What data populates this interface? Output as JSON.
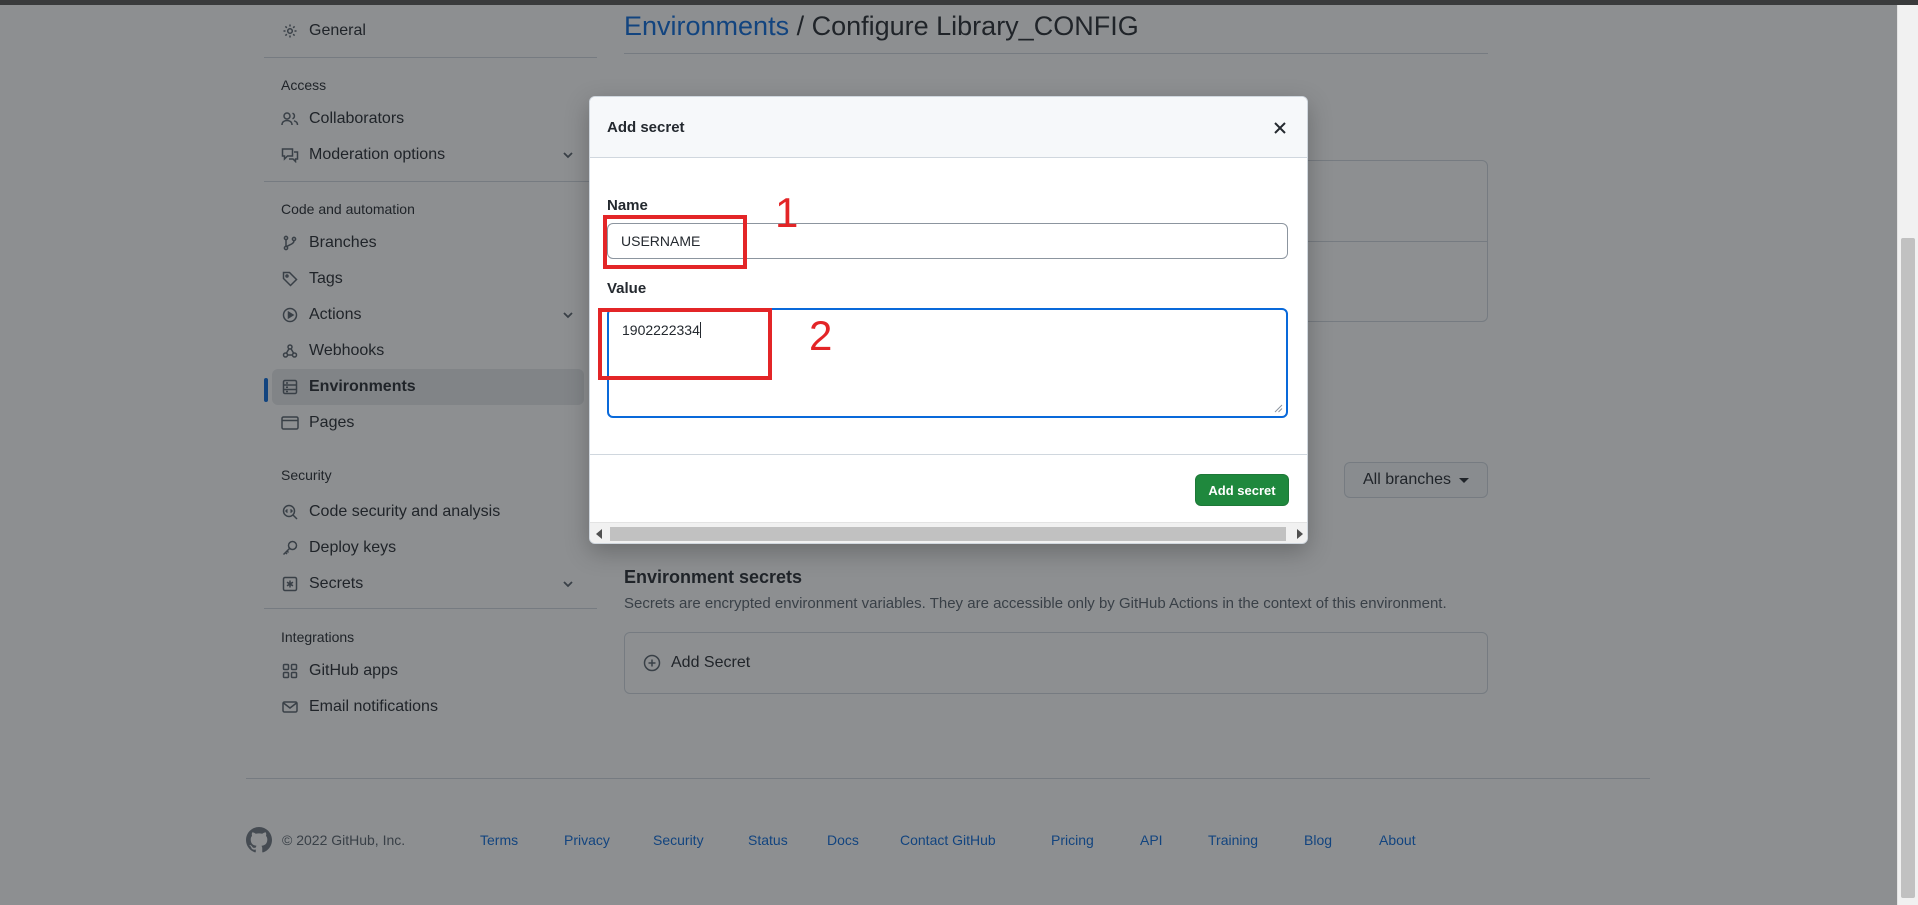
{
  "sidebar": {
    "general": "General",
    "sections": {
      "access": "Access",
      "code": "Code and automation",
      "security": "Security",
      "integrations": "Integrations"
    },
    "items": {
      "collaborators": "Collaborators",
      "moderation": "Moderation options",
      "branches": "Branches",
      "tags": "Tags",
      "actions": "Actions",
      "webhooks": "Webhooks",
      "environments": "Environments",
      "pages": "Pages",
      "code_security": "Code security and analysis",
      "deploy_keys": "Deploy keys",
      "secrets": "Secrets",
      "github_apps": "GitHub apps",
      "email_notifications": "Email notifications"
    }
  },
  "main": {
    "breadcrumb_link": "Environments",
    "breadcrumb_rest": " / Configure Library_CONFIG",
    "branches_button": "All branches",
    "env_secrets_title": "Environment secrets",
    "env_secrets_desc": "Secrets are encrypted environment variables. They are accessible only by GitHub Actions in the context of this environment.",
    "add_secret_link": "Add Secret"
  },
  "dialog": {
    "title": "Add secret",
    "name_label": "Name",
    "name_value": "USERNAME",
    "value_label": "Value",
    "value_value": "1902222334",
    "submit_label": "Add secret"
  },
  "annotations": {
    "one": "1",
    "two": "2"
  },
  "footer": {
    "copyright": "© 2022 GitHub, Inc.",
    "links": {
      "terms": "Terms",
      "privacy": "Privacy",
      "security": "Security",
      "status": "Status",
      "docs": "Docs",
      "contact": "Contact GitHub",
      "pricing": "Pricing",
      "api": "API",
      "training": "Training",
      "blog": "Blog",
      "about": "About"
    }
  },
  "colors": {
    "link": "#0969da",
    "primary_button": "#1f883d",
    "annotation": "#e32527",
    "overlay": "rgba(27,31,36,0.5)"
  }
}
